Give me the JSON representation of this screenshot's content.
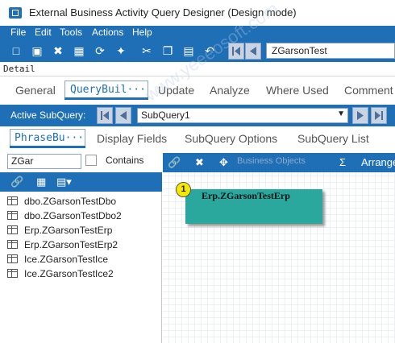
{
  "window": {
    "title": "External Business Activity Query Designer (Design mode)"
  },
  "menu": [
    "File",
    "Edit",
    "Tools",
    "Actions",
    "Help"
  ],
  "toolbar": {
    "icons": [
      "new-icon",
      "save-icon",
      "close-icon",
      "clipboard-icon",
      "refresh-icon",
      "clean-icon",
      "cut-icon",
      "copy-icon",
      "paste-icon",
      "undo-icon"
    ],
    "query_name": "ZGarsonTest"
  },
  "detail": {
    "label": "Detail"
  },
  "main_tabs": [
    "General",
    "QueryBuil···",
    "Update",
    "Analyze",
    "Where Used",
    "Comment"
  ],
  "subquery": {
    "label": "Active SubQuery:",
    "value": "SubQuery1"
  },
  "sub_tabs": [
    "PhraseBu···",
    "Display Fields",
    "SubQuery Options",
    "SubQuery List"
  ],
  "left_pane": {
    "search_value": "ZGar",
    "contains_label": "Contains",
    "contains_checked": false,
    "objects": [
      "dbo.ZGarsonTestDbo",
      "dbo.ZGarsonTestDbo2",
      "Erp.ZGarsonTestErp",
      "Erp.ZGarsonTestErp2",
      "Ice.ZGarsonTestIce",
      "Ice.ZGarsonTestIce2"
    ]
  },
  "right_pane": {
    "toolbar": {
      "business_objects_label": "Business Objects",
      "sigma": "Σ",
      "arrange_label": "Arrange"
    },
    "entity": {
      "badge": "1",
      "name": "Erp.ZGarsonTestErp"
    }
  },
  "watermark": "www.yeeeosoft.com",
  "colors": {
    "accent": "#1f6fb6",
    "entity": "#2aa89d",
    "badge": "#f7e800"
  }
}
